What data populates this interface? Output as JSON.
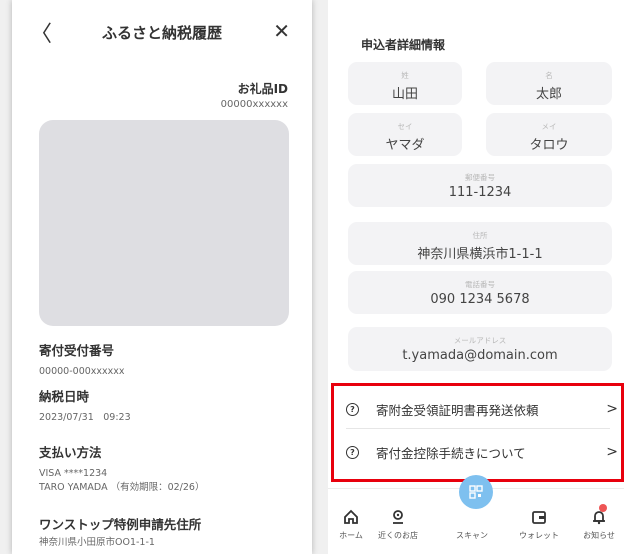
{
  "left": {
    "title": "ふるさと納税履歴",
    "back": "〈",
    "close": "✕",
    "gift_id_label": "お礼品ID",
    "gift_id_value": "00000xxxxxx",
    "donation_number_label": "寄付受付番号",
    "donation_number_value": "00000-000xxxxxx",
    "payment_date_label": "納税日時",
    "payment_date_value": "2023/07/31　09:23",
    "payment_method_label": "支払い方法",
    "payment_method_card": "VISA ****1234",
    "payment_method_holder": "TARO YAMADA （有効期限：02/26）",
    "onestop_label": "ワンストップ特例申請先住所",
    "onestop_value": "神奈川県小田原市OO1-1-1"
  },
  "right": {
    "section_title": "申込者詳細情報",
    "fields": {
      "sei": {
        "caption": "姓",
        "value": "山田"
      },
      "mei": {
        "caption": "名",
        "value": "太郎"
      },
      "sei_kana": {
        "caption": "セイ",
        "value": "ヤマダ"
      },
      "mei_kana": {
        "caption": "メイ",
        "value": "タロウ"
      },
      "zip": {
        "caption": "郵便番号",
        "value": "111-1234"
      },
      "address": {
        "caption": "住所",
        "value": "神奈川県横浜市1-1-1"
      },
      "tel": {
        "caption": "電話番号",
        "value": "090 1234 5678"
      },
      "email": {
        "caption": "メールアドレス",
        "value": "t.yamada@domain.com"
      }
    },
    "menu": [
      {
        "label": "寄附金受領証明書再発送依頼"
      },
      {
        "label": "寄付金控除手続きについて"
      }
    ]
  },
  "nav": {
    "home": "ホーム",
    "shop": "近くのお店",
    "scan": "スキャン",
    "wallet": "ウォレット",
    "news": "お知らせ"
  },
  "colors": {
    "highlight": "#e8000d",
    "scan_button": "#7ec0ef",
    "field_bg": "#f3f3f5",
    "image_placeholder": "#dedee2"
  }
}
